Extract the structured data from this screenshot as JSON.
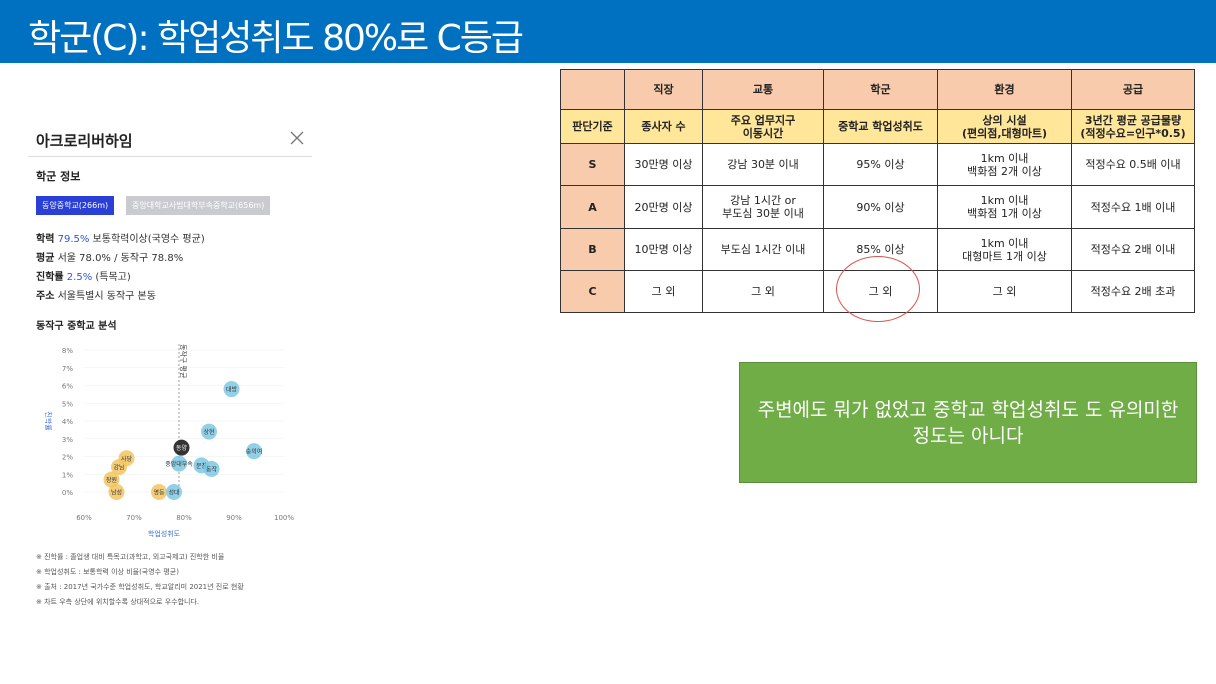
{
  "header": {
    "title": "학군(C): 학업성취도 80%로 C등급"
  },
  "panel": {
    "title": "아크로리버하임",
    "section_school": "학군 정보",
    "tabs": [
      "동양중학교(266m)",
      "중앙대학교사범대학부속중학교(656m)"
    ],
    "info": [
      {
        "label": "학력",
        "value": "79.5%",
        "rest": " 보통학력이상(국영수 평균)"
      },
      {
        "label": "평균",
        "value": "",
        "rest": " 서울 78.0% / 동작구 78.8%"
      },
      {
        "label": "진학률",
        "value": "2.5%",
        "rest": " (특목고)"
      },
      {
        "label": "주소",
        "value": "",
        "rest": " 서울특별시 동작구 본동"
      }
    ],
    "section_analysis": "동작구 중학교 분석",
    "notes": [
      "※ 진학률 : 졸업생 대비 특목고(과학고, 외고국제고) 진학한 비율",
      "※ 학업성취도 : 보통학력 이상 비율(국영수 평균)",
      "※ 출처 : 2017년 국가수준 학업성취도, 학교알리미 2021년 진로 현황",
      "※ 차트 우측 상단에 위치할수록 상대적으로 우수합니다."
    ]
  },
  "chart_data": {
    "type": "scatter",
    "xlabel": "학업성취도",
    "ylabel": "진학률",
    "xlim": [
      60,
      100
    ],
    "ylim": [
      0,
      8
    ],
    "xticks": [
      "60%",
      "70%",
      "80%",
      "90%",
      "100%"
    ],
    "yticks": [
      "0%",
      "1%",
      "2%",
      "3%",
      "4%",
      "5%",
      "6%",
      "7%",
      "8%"
    ],
    "reference_line_label": "동작구 평균",
    "reference_x": 79.0,
    "points": [
      {
        "label": "대방",
        "x": 89.5,
        "y": 5.8,
        "color": "#7ec8e3"
      },
      {
        "label": "상현",
        "x": 85.0,
        "y": 3.4,
        "color": "#7ec8e3"
      },
      {
        "label": "동양",
        "x": 79.5,
        "y": 2.5,
        "color": "#111111"
      },
      {
        "label": "숭의여",
        "x": 94.0,
        "y": 2.3,
        "color": "#7ec8e3"
      },
      {
        "label": "중앙대부속",
        "x": 79.0,
        "y": 1.6,
        "color": "#7ec8e3"
      },
      {
        "label": "문창",
        "x": 83.5,
        "y": 1.5,
        "color": "#7ec8e3"
      },
      {
        "label": "동작",
        "x": 85.5,
        "y": 1.3,
        "color": "#7ec8e3"
      },
      {
        "label": "강남",
        "x": 67.0,
        "y": 1.4,
        "color": "#f2c462"
      },
      {
        "label": "사당",
        "x": 68.5,
        "y": 1.9,
        "color": "#f2c462"
      },
      {
        "label": "장원",
        "x": 65.5,
        "y": 0.7,
        "color": "#f2c462"
      },
      {
        "label": "남성",
        "x": 66.5,
        "y": 0.0,
        "color": "#f2c462"
      },
      {
        "label": "영등",
        "x": 75.0,
        "y": 0.0,
        "color": "#f2c462"
      },
      {
        "label": "성대",
        "x": 78.0,
        "y": 0.0,
        "color": "#7ec8e3"
      }
    ]
  },
  "table": {
    "headers": [
      "",
      "직장",
      "교통",
      "학군",
      "환경",
      "공급"
    ],
    "subheaders": [
      "판단기준",
      "종사자 수",
      "주요 업무지구\n이동시간",
      "중학교 학업성취도",
      "상의 시설\n(편의점,대형마트)",
      "3년간 평균 공급물량\n(적정수요=인구*0.5)"
    ],
    "rows": [
      [
        "S",
        "30만명 이상",
        "강남 30분 이내",
        "95% 이상",
        "1km 이내\n백화점 2개 이상",
        "적정수요 0.5배 이내"
      ],
      [
        "A",
        "20만명 이상",
        "강남 1시간 or\n부도심 30분 이내",
        "90% 이상",
        "1km 이내\n백화점 1개 이상",
        "적정수요 1배 이내"
      ],
      [
        "B",
        "10만명 이상",
        "부도심 1시간 이내",
        "85% 이상",
        "1km 이내\n대형마트 1개 이상",
        "적정수요 2배 이내"
      ],
      [
        "C",
        "그 외",
        "그 외",
        "그 외",
        "그 외",
        "적정수요 2배 초과"
      ]
    ]
  },
  "callout": {
    "text": "주변에도 뭐가 없었고 중학교 학업성취도 도 유의미한 정도는 아니다"
  }
}
